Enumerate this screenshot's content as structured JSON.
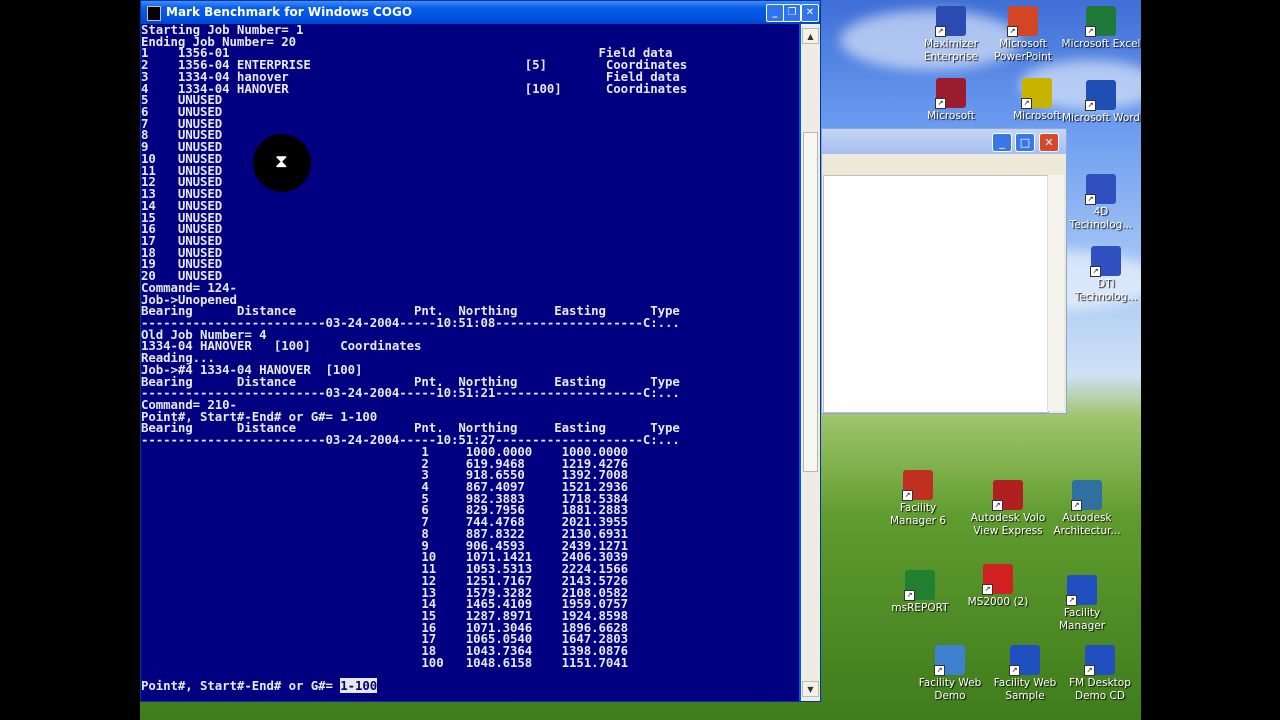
{
  "console": {
    "title": "Mark Benchmark for Windows COGO",
    "minimize": "_",
    "restore": "❐",
    "close": "✕",
    "lines": [
      "Starting Job Number= 1",
      "Ending Job Number= 20",
      "1    1356-01                                                  Field data",
      "2    1356-04 ENTERPRISE                             [5]        Coordinates",
      "3    1334-04 hanover                                           Field data",
      "4    1334-04 HANOVER                                [100]      Coordinates",
      "5    UNUSED",
      "6    UNUSED",
      "7    UNUSED",
      "8    UNUSED",
      "9    UNUSED",
      "10   UNUSED",
      "11   UNUSED",
      "12   UNUSED",
      "13   UNUSED",
      "14   UNUSED",
      "15   UNUSED",
      "16   UNUSED",
      "17   UNUSED",
      "18   UNUSED",
      "19   UNUSED",
      "20   UNUSED",
      "Command= 124-",
      "Job->Unopened",
      "Bearing      Distance                Pnt.  Northing     Easting      Type",
      "-------------------------03-24-2004-----10:51:08--------------------C:...",
      "Old Job Number= 4",
      "1334-04 HANOVER   [100]    Coordinates",
      "Reading...",
      "Job->#4 1334-04 HANOVER  [100]",
      "Bearing      Distance                Pnt.  Northing     Easting      Type",
      "-------------------------03-24-2004-----10:51:21--------------------C:...",
      "Command= 210-",
      "Point#, Start#-End# or G#= 1-100",
      "Bearing      Distance                Pnt.  Northing     Easting      Type",
      "-------------------------03-24-2004-----10:51:27--------------------C:...",
      "                                      1     1000.0000    1000.0000",
      "                                      2     619.9468     1219.4276",
      "                                      3     918.6550     1392.7008",
      "                                      4     867.4097     1521.2936",
      "                                      5     982.3883     1718.5384",
      "                                      6     829.7956     1881.2883",
      "                                      7     744.4768     2021.3955",
      "                                      8     887.8322     2130.6931",
      "                                      9     906.4593     2439.1271",
      "                                      10    1071.1421    2406.3039",
      "                                      11    1053.5313    2224.1566",
      "                                      12    1251.7167    2143.5726",
      "                                      13    1579.3282    2108.0582",
      "                                      14    1465.4109    1959.0757",
      "                                      15    1287.8971    1924.8598",
      "                                      16    1071.3046    1896.6628",
      "                                      17    1065.0540    1647.2803",
      "                                      18    1043.7364    1398.0876",
      "                                      100   1048.6158    1151.7041",
      ""
    ],
    "prompt": "Point#, Start#-End# or G#= ",
    "prompt_input": "1-100"
  },
  "desktop_icons": [
    {
      "label": "Maximizer Enterprise",
      "icon": "maximizer-icon",
      "color": "#2a4bb0"
    },
    {
      "label": "Microsoft PowerPoint",
      "icon": "powerpoint-icon",
      "color": "#d24625"
    },
    {
      "label": "Microsoft Excel",
      "icon": "excel-icon",
      "color": "#1f7a3a"
    },
    {
      "label": "Microsoft",
      "icon": "access-icon",
      "color": "#9b1c2e"
    },
    {
      "label": "Microsoft",
      "icon": "publisher-icon",
      "color": "#c8b400"
    },
    {
      "label": "Microsoft Word",
      "icon": "word-icon",
      "color": "#1f4fb3"
    },
    {
      "label": "4D Technolog...",
      "icon": "4d-technology-icon",
      "color": "#3050c0"
    },
    {
      "label": "DTI Technolog...",
      "icon": "dti-technology-icon",
      "color": "#3050c0"
    },
    {
      "label": "Facility Manager 6",
      "icon": "facility-manager-icon",
      "color": "#c03020"
    },
    {
      "label": "Autodesk Volo View Express",
      "icon": "volo-view-icon",
      "color": "#b02020"
    },
    {
      "label": "Autodesk Architectur...",
      "icon": "autodesk-architecture-icon",
      "color": "#3070a0"
    },
    {
      "label": "msREPORT",
      "icon": "msreport-icon",
      "color": "#208030"
    },
    {
      "label": "MS2000 (2)",
      "icon": "ms2000-icon",
      "color": "#d02020"
    },
    {
      "label": "Facility Manager",
      "icon": "fm-icon",
      "color": "#2050c0"
    },
    {
      "label": "Facility Web Demo",
      "icon": "facility-web-demo-icon",
      "color": "#4080d0"
    },
    {
      "label": "Facility Web Sample",
      "icon": "fw-icon",
      "color": "#2050c0"
    },
    {
      "label": "FM Desktop Demo CD",
      "icon": "fm-desktop-icon",
      "color": "#2050c0"
    }
  ],
  "background_window": {
    "minimize": "_",
    "maximize": "□",
    "close": "✕"
  }
}
